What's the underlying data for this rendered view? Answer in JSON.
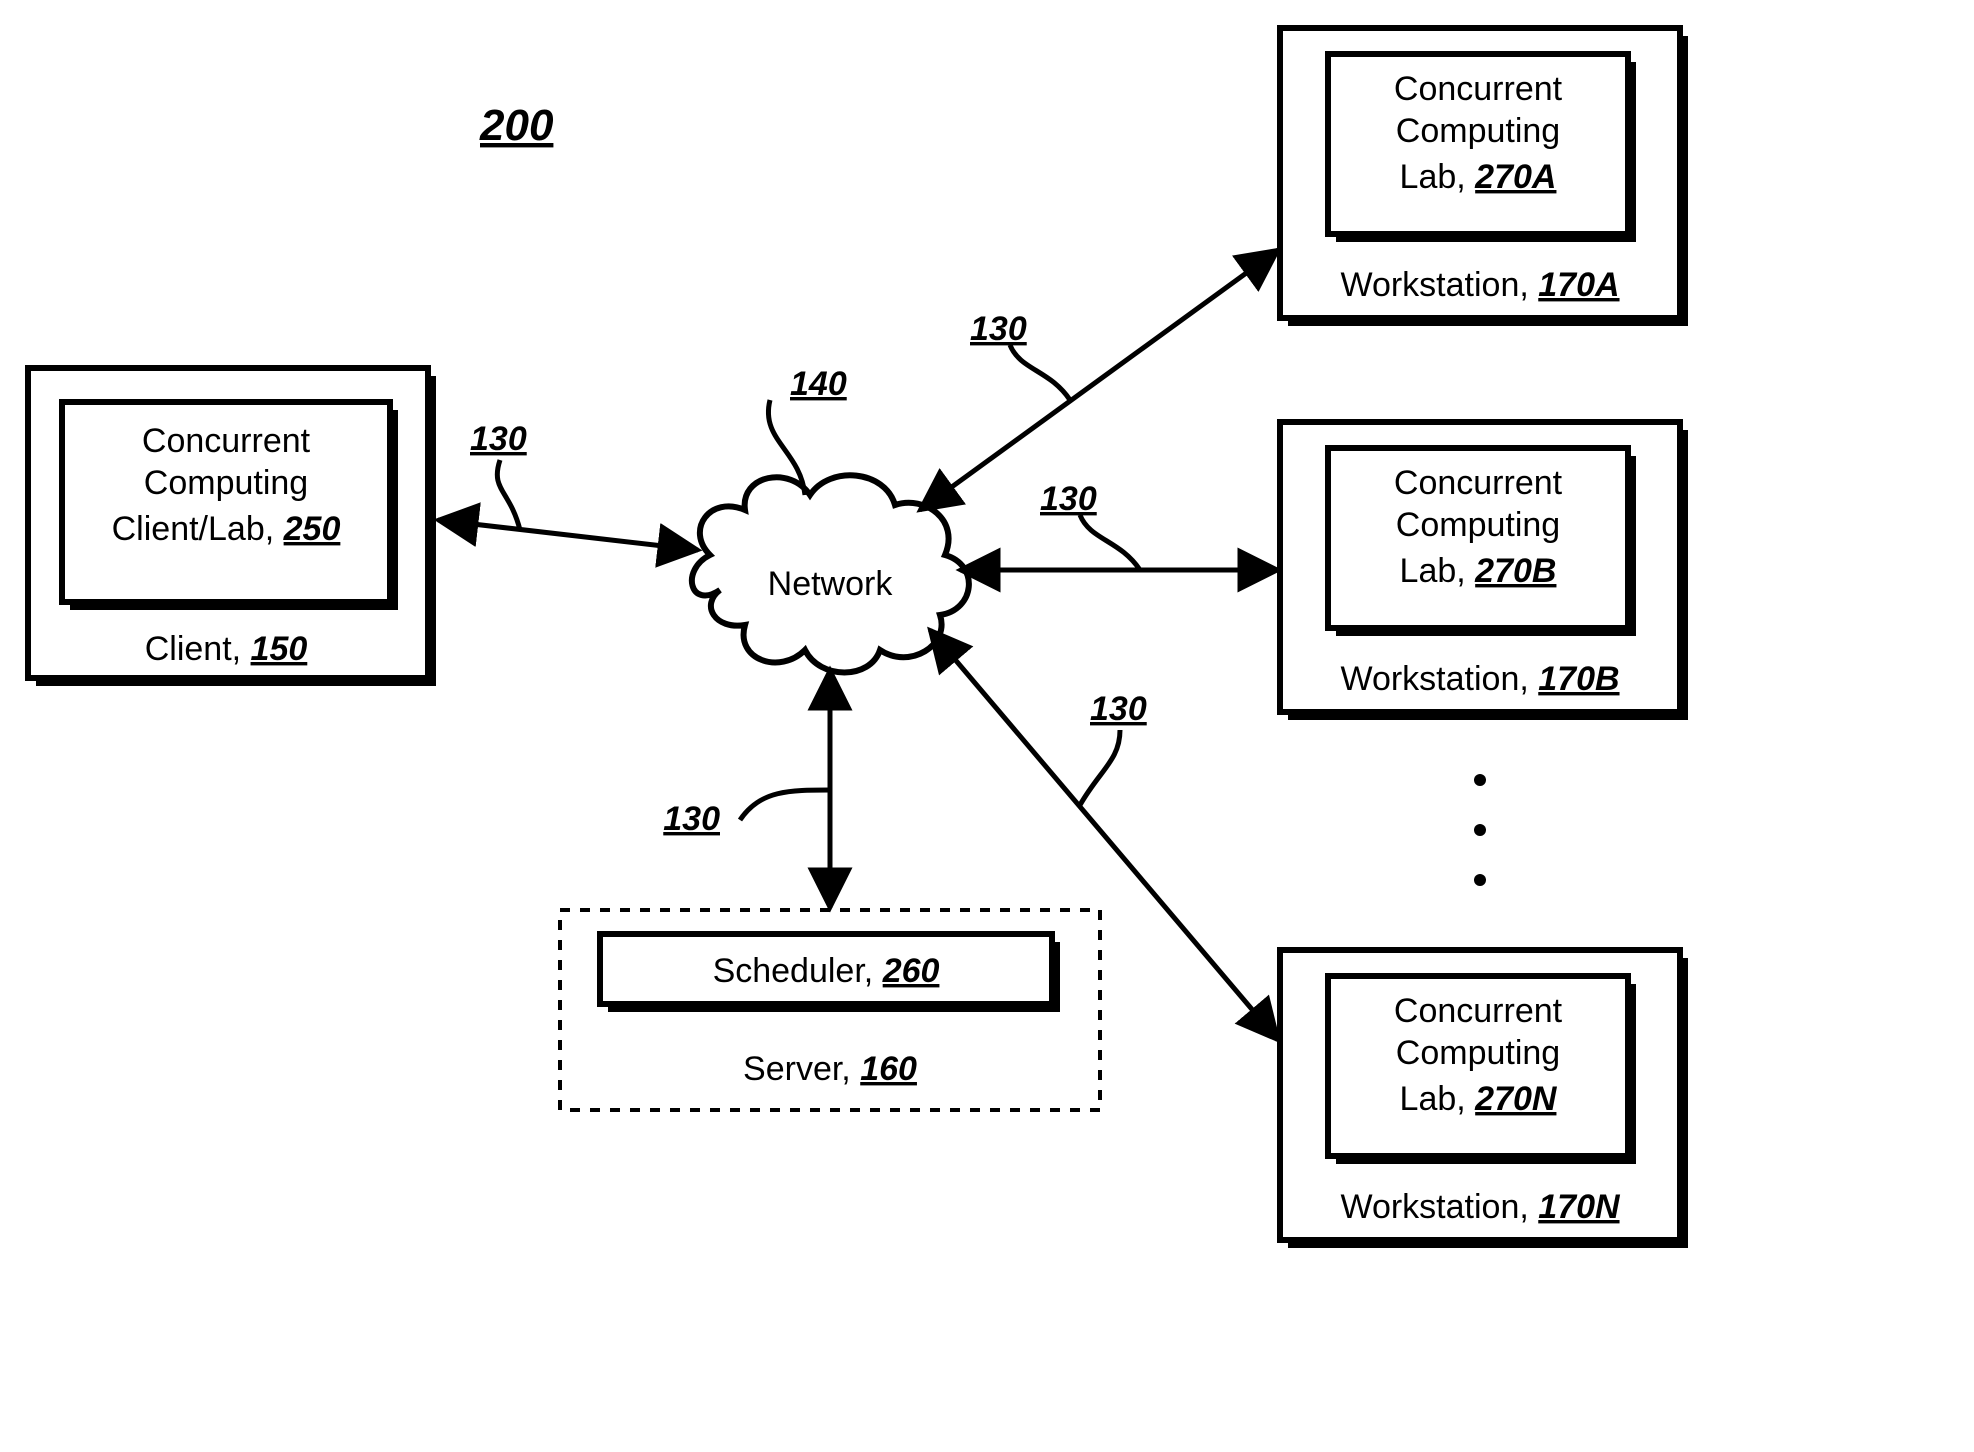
{
  "figure_ref": "200",
  "network": {
    "label": "Network",
    "ref": "140"
  },
  "connection_ref": "130",
  "client": {
    "inner_line1": "Concurrent",
    "inner_line2": "Computing",
    "inner_line3_text": "Client/Lab, ",
    "inner_line3_ref": "250",
    "outer_text": "Client, ",
    "outer_ref": "150"
  },
  "server": {
    "inner_text": "Scheduler, ",
    "inner_ref": "260",
    "outer_text": "Server, ",
    "outer_ref": "160"
  },
  "workstations": [
    {
      "inner_line1": "Concurrent",
      "inner_line2": "Computing",
      "inner_line3_text": "Lab, ",
      "inner_line3_ref": "270A",
      "outer_text": "Workstation, ",
      "outer_ref": "170A"
    },
    {
      "inner_line1": "Concurrent",
      "inner_line2": "Computing",
      "inner_line3_text": "Lab, ",
      "inner_line3_ref": "270B",
      "outer_text": "Workstation, ",
      "outer_ref": "170B"
    },
    {
      "inner_line1": "Concurrent",
      "inner_line2": "Computing",
      "inner_line3_text": "Lab, ",
      "inner_line3_ref": "270N",
      "outer_text": "Workstation, ",
      "outer_ref": "170N"
    }
  ],
  "ellipsis": "⋮"
}
